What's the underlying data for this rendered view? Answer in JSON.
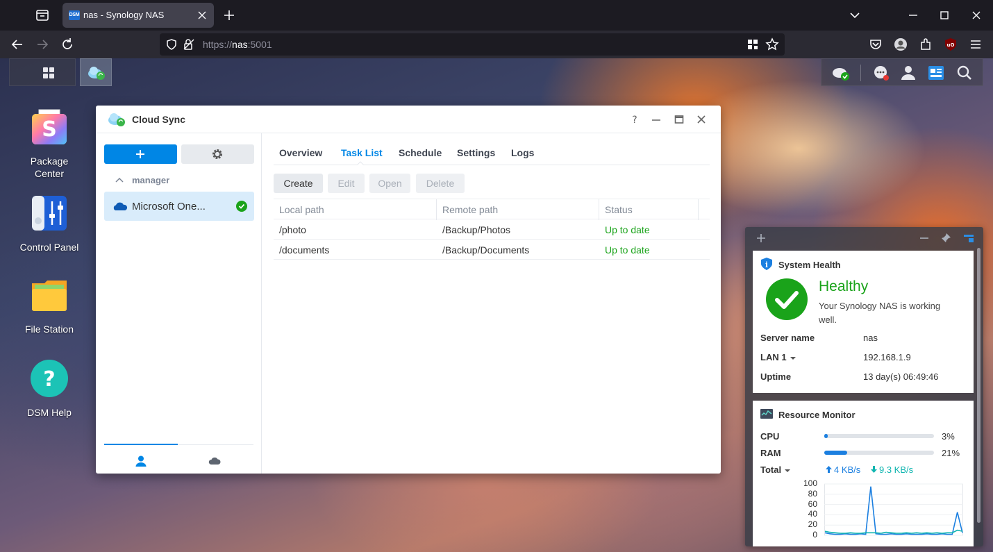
{
  "browser": {
    "tab_title": "nas - Synology NAS",
    "favicon_text": "DSM",
    "url_scheme": "https://",
    "url_host": "nas",
    "url_port": ":5001"
  },
  "desktop": {
    "icons": [
      {
        "label_line1": "Package",
        "label_line2": "Center"
      },
      {
        "label_line1": "Control Panel"
      },
      {
        "label_line1": "File Station"
      },
      {
        "label_line1": "DSM Help"
      }
    ]
  },
  "window": {
    "title": "Cloud Sync",
    "sidebar": {
      "group_label": "manager",
      "connection_label": "Microsoft One..."
    },
    "tabs": [
      "Overview",
      "Task List",
      "Schedule",
      "Settings",
      "Logs"
    ],
    "active_tab": "Task List",
    "toolbar": {
      "create": "Create",
      "edit": "Edit",
      "open": "Open",
      "delete": "Delete"
    },
    "grid": {
      "headers": [
        "Local path",
        "Remote path",
        "Status"
      ],
      "rows": [
        {
          "local": "/photo",
          "remote": "/Backup/Photos",
          "status": "Up to date"
        },
        {
          "local": "/documents",
          "remote": "/Backup/Documents",
          "status": "Up to date"
        }
      ]
    }
  },
  "system_health": {
    "title": "System Health",
    "status": "Healthy",
    "description": "Your Synology NAS is working well.",
    "server_name_label": "Server name",
    "server_name": "nas",
    "lan_label": "LAN 1",
    "lan_ip": "192.168.1.9",
    "uptime_label": "Uptime",
    "uptime": "13 day(s) 06:49:46"
  },
  "resource_monitor": {
    "title": "Resource Monitor",
    "cpu_label": "CPU",
    "cpu_pct": "3%",
    "cpu_value": 3,
    "ram_label": "RAM",
    "ram_pct": "21%",
    "ram_value": 21,
    "total_label": "Total",
    "upload": "4 KB/s",
    "download": "9.3 KB/s",
    "colors": {
      "upload": "#1b7fe0",
      "download": "#0fb5b0"
    }
  },
  "chart_data": {
    "type": "line",
    "yticks": [
      "100",
      "80",
      "60",
      "40",
      "20",
      "0"
    ],
    "ylim": [
      0,
      100
    ],
    "series": [
      {
        "values": [
          5,
          3,
          2,
          2,
          3,
          2,
          2,
          3,
          2,
          95,
          3,
          2,
          2,
          3,
          2,
          2,
          3,
          2,
          2,
          2,
          3,
          2,
          2,
          3,
          2,
          2,
          45,
          5
        ]
      },
      {
        "values": [
          8,
          6,
          5,
          4,
          4,
          5,
          4,
          4,
          5,
          5,
          5,
          4,
          6,
          5,
          4,
          4,
          5,
          4,
          5,
          4,
          5,
          4,
          5,
          4,
          5,
          5,
          10,
          8
        ]
      }
    ]
  }
}
